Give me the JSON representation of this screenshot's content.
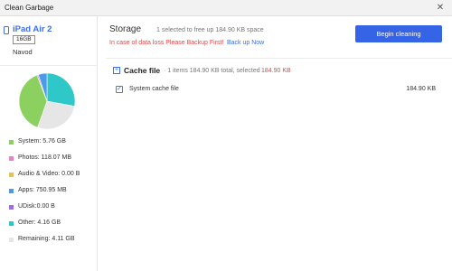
{
  "window": {
    "title": "Clean Garbage",
    "close_glyph": "✕"
  },
  "device": {
    "name": "iPad Air 2",
    "capacity": "16GB",
    "owner": "Navod"
  },
  "usage": {
    "segments": [
      {
        "label": "System: 5.76 GB",
        "value": 5.76,
        "color": "#8cd160"
      },
      {
        "label": "Photos: 118.07 MB",
        "value": 0.118,
        "color": "#e982c7"
      },
      {
        "label": "Audio & Video: 0.00 B",
        "value": 0,
        "color": "#e5c25a"
      },
      {
        "label": "Apps: 750.95 MB",
        "value": 0.751,
        "color": "#4c9ae8"
      },
      {
        "label": "UDisk:0.00 B",
        "value": 0,
        "color": "#a06ae8"
      },
      {
        "label": "Other: 4.16 GB",
        "value": 4.16,
        "color": "#2fc8c8"
      },
      {
        "label": "Remaining: 4.11 GB",
        "value": 4.11,
        "color": "#e6e6e6"
      }
    ]
  },
  "storage": {
    "title": "Storage",
    "summary": "1 selected to free up 184.90 KB space",
    "warning": "In case of data loss Please Backup First!",
    "backup_link": "Back up Now",
    "begin_button": "Begin cleaning"
  },
  "category": {
    "toggle_glyph": "+",
    "title": "Cache file",
    "summary": "· 1 items 184.90 KB total, selected",
    "selected_size": "184.90 KB",
    "items": [
      {
        "label": "System cache file",
        "size": "184.90 KB",
        "checked_glyph": "✓"
      }
    ]
  },
  "colors": {
    "accent": "#3a6fe8",
    "button": "#3564e6",
    "warning": "#e04848"
  }
}
